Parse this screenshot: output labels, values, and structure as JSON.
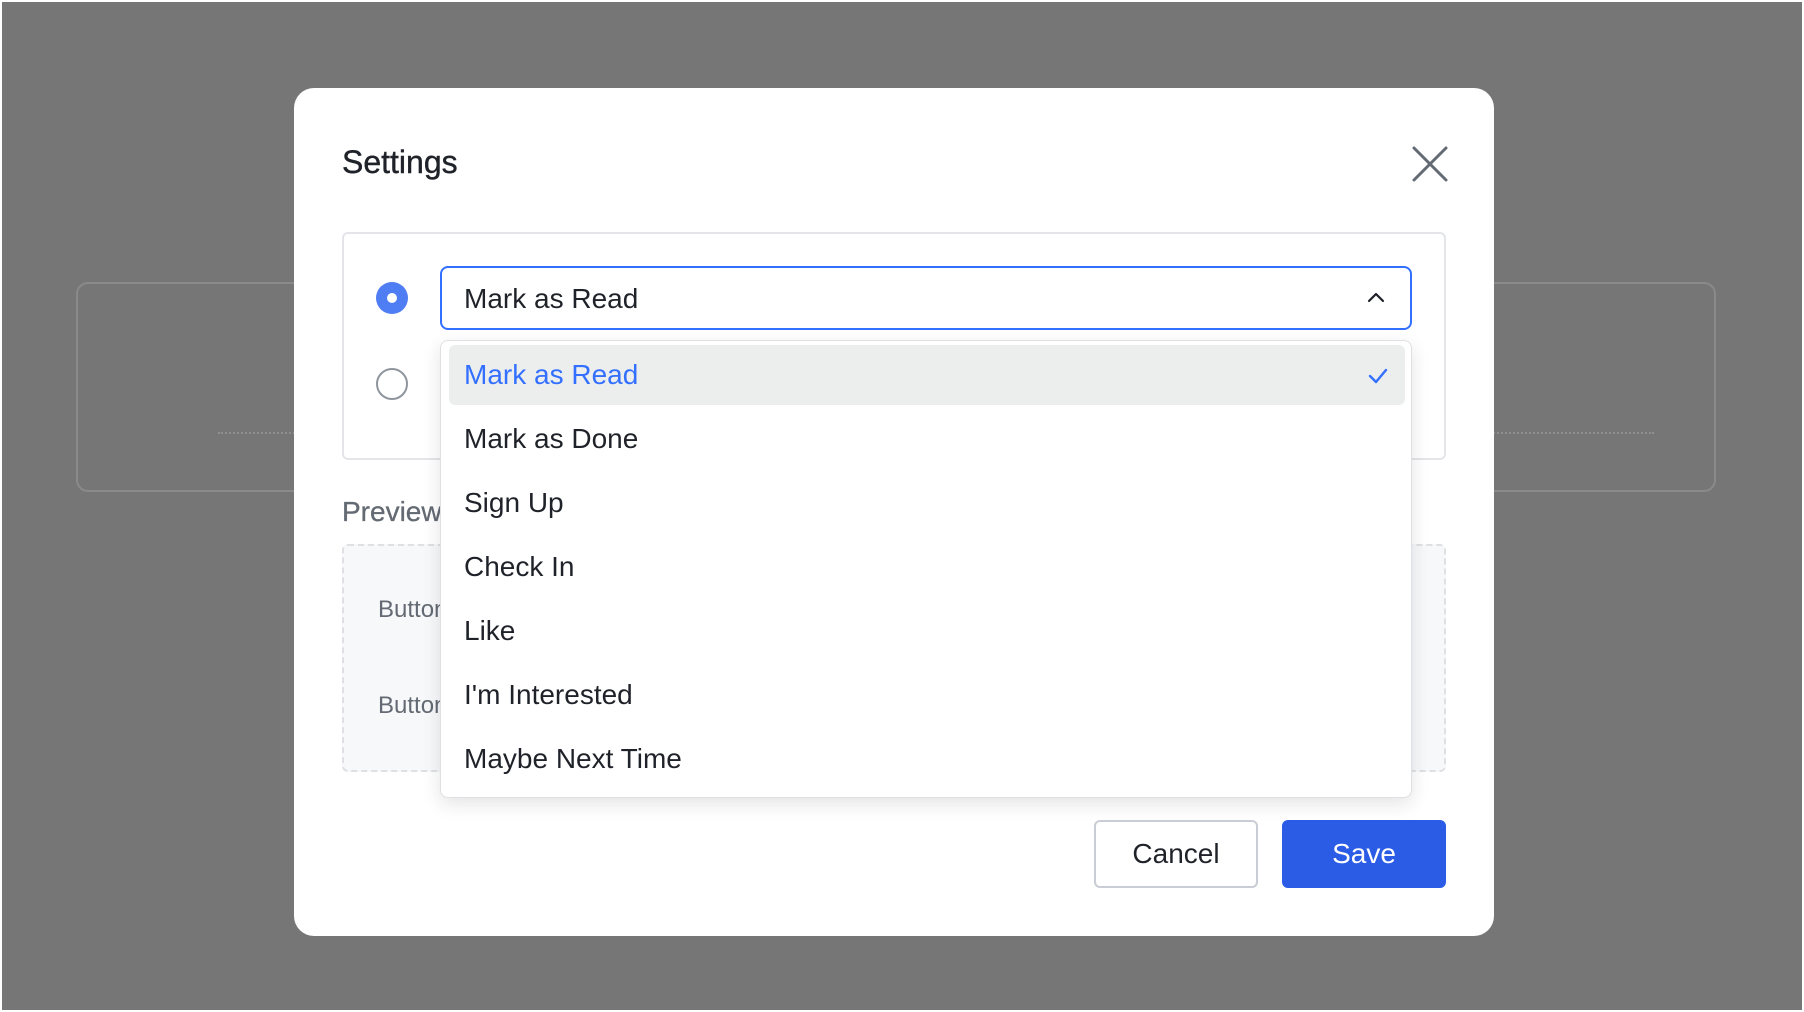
{
  "modal": {
    "title": "Settings",
    "close_icon": "close-icon"
  },
  "options": {
    "radio_1_checked": true,
    "radio_2_checked": false
  },
  "select": {
    "value": "Mark as Read",
    "expanded": true,
    "chevron_icon": "chevron-up-icon"
  },
  "dropdown": {
    "items": [
      {
        "label": "Mark as Read",
        "selected": true
      },
      {
        "label": "Mark as Done",
        "selected": false
      },
      {
        "label": "Sign Up",
        "selected": false
      },
      {
        "label": "Check In",
        "selected": false
      },
      {
        "label": "Like",
        "selected": false
      },
      {
        "label": "I'm Interested",
        "selected": false
      },
      {
        "label": "Maybe Next Time",
        "selected": false
      }
    ],
    "check_icon": "check-icon"
  },
  "preview": {
    "label": "Preview",
    "row_1": "Button",
    "row_2": "Button"
  },
  "footer": {
    "cancel_label": "Cancel",
    "save_label": "Save"
  },
  "colors": {
    "accent": "#3370ff",
    "primary_button": "#2b5ce6",
    "radio_checked": "#4f7df3",
    "overlay": "#767676"
  }
}
